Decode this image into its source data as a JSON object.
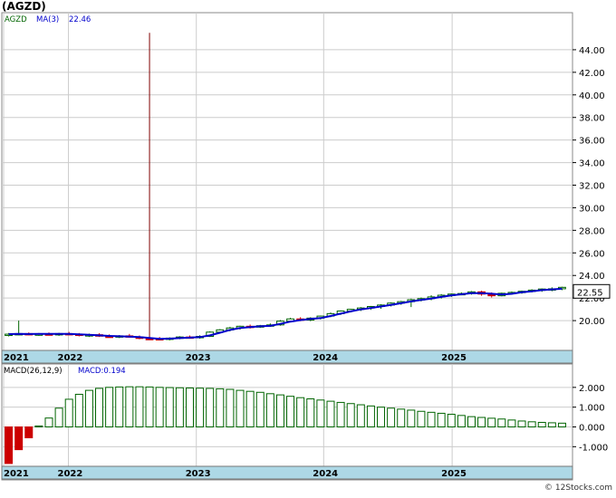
{
  "header": {
    "title": "(AGZD)",
    "symbol": "AGZD",
    "ma_label": "MA(3)",
    "ma_value": "22.46"
  },
  "footer": {
    "credit": "© 12Stocks.com"
  },
  "colors": {
    "up_candle": "#006400",
    "down_candle": "#cc0000",
    "ma_line": "#0000cc",
    "axis_band": "#add8e6",
    "grid": "#cccccc",
    "macd_bar_pos": "#006400",
    "macd_bar_neg": "#cc0000",
    "spike": "#800000"
  },
  "chart_data": [
    {
      "type": "candlestick",
      "symbol": "AGZD",
      "last_price_label": "22.55",
      "ylim": [
        17.6,
        46.0
      ],
      "y_ticks": [
        "20.00",
        "22.00",
        "24.00",
        "26.00",
        "28.00",
        "30.00",
        "32.00",
        "34.00",
        "36.00",
        "38.00",
        "40.00",
        "42.00",
        "44.00"
      ],
      "x_ticks": [
        "2021",
        "2022",
        "2023",
        "2024",
        "2025"
      ],
      "grid": true,
      "series": [
        {
          "name": "AGZD",
          "ohlc": [
            [
              18.75,
              18.9,
              18.6,
              18.8
            ],
            [
              18.8,
              20.0,
              18.7,
              18.85
            ],
            [
              18.85,
              18.95,
              18.7,
              18.78
            ],
            [
              18.78,
              18.9,
              18.65,
              18.82
            ],
            [
              18.82,
              18.95,
              18.7,
              18.8
            ],
            [
              18.8,
              18.92,
              18.65,
              18.85
            ],
            [
              18.85,
              19.0,
              18.72,
              18.8
            ],
            [
              18.8,
              18.9,
              18.6,
              18.7
            ],
            [
              18.7,
              18.85,
              18.55,
              18.75
            ],
            [
              18.75,
              18.88,
              18.55,
              18.62
            ],
            [
              18.62,
              18.78,
              18.48,
              18.55
            ],
            [
              18.55,
              18.72,
              18.45,
              18.65
            ],
            [
              18.65,
              18.82,
              18.5,
              18.55
            ],
            [
              18.55,
              18.68,
              18.35,
              18.42
            ],
            [
              18.42,
              45.5,
              18.3,
              18.4
            ],
            [
              18.4,
              18.55,
              18.25,
              18.35
            ],
            [
              18.35,
              18.52,
              18.25,
              18.45
            ],
            [
              18.45,
              18.62,
              18.35,
              18.55
            ],
            [
              18.55,
              18.68,
              18.4,
              18.48
            ],
            [
              18.48,
              18.7,
              18.4,
              18.6
            ],
            [
              18.6,
              19.05,
              18.55,
              18.98
            ],
            [
              18.98,
              19.25,
              18.9,
              19.18
            ],
            [
              19.18,
              19.45,
              19.05,
              19.35
            ],
            [
              19.35,
              19.55,
              19.2,
              19.5
            ],
            [
              19.5,
              19.65,
              19.3,
              19.42
            ],
            [
              19.42,
              19.62,
              19.35,
              19.55
            ],
            [
              19.55,
              19.75,
              19.45,
              19.62
            ],
            [
              19.62,
              20.05,
              19.55,
              19.95
            ],
            [
              19.95,
              20.25,
              19.85,
              20.15
            ],
            [
              20.15,
              20.3,
              19.95,
              20.05
            ],
            [
              20.05,
              20.3,
              19.95,
              20.22
            ],
            [
              20.22,
              20.45,
              20.1,
              20.4
            ],
            [
              20.4,
              20.72,
              20.3,
              20.62
            ],
            [
              20.62,
              20.9,
              20.5,
              20.85
            ],
            [
              20.85,
              21.05,
              20.72,
              21.0
            ],
            [
              21.0,
              21.2,
              20.85,
              21.12
            ],
            [
              21.12,
              21.3,
              20.95,
              21.25
            ],
            [
              21.25,
              21.45,
              21.05,
              21.38
            ],
            [
              21.38,
              21.62,
              21.25,
              21.55
            ],
            [
              21.55,
              21.75,
              21.4,
              21.68
            ],
            [
              21.68,
              21.95,
              21.2,
              21.85
            ],
            [
              21.85,
              22.05,
              21.7,
              21.95
            ],
            [
              21.95,
              22.25,
              21.8,
              22.1
            ],
            [
              22.1,
              22.35,
              21.95,
              22.25
            ],
            [
              22.25,
              22.4,
              22.1,
              22.35
            ],
            [
              22.35,
              22.5,
              22.25,
              22.4
            ],
            [
              22.4,
              22.62,
              22.3,
              22.55
            ],
            [
              22.55,
              22.65,
              22.2,
              22.35
            ],
            [
              22.35,
              22.5,
              22.05,
              22.2
            ],
            [
              22.2,
              22.48,
              22.15,
              22.42
            ],
            [
              22.42,
              22.58,
              22.3,
              22.5
            ],
            [
              22.5,
              22.66,
              22.38,
              22.6
            ],
            [
              22.6,
              22.78,
              22.5,
              22.7
            ],
            [
              22.7,
              22.85,
              22.55,
              22.8
            ],
            [
              22.8,
              22.95,
              22.6,
              22.82
            ],
            [
              22.82,
              23.0,
              22.7,
              22.95
            ]
          ]
        },
        {
          "name": "MA(3)",
          "values": [
            18.8,
            18.82,
            18.81,
            18.82,
            18.82,
            18.82,
            18.82,
            18.78,
            18.75,
            18.69,
            18.64,
            18.61,
            18.58,
            18.54,
            18.46,
            18.39,
            18.4,
            18.45,
            18.49,
            18.54,
            18.69,
            18.92,
            19.17,
            19.34,
            19.42,
            19.49,
            19.53,
            19.71,
            19.91,
            20.05,
            20.14,
            20.22,
            20.41,
            20.62,
            20.82,
            20.99,
            21.12,
            21.25,
            21.39,
            21.54,
            21.7,
            21.83,
            21.96,
            22.1,
            22.23,
            22.33,
            22.43,
            22.43,
            22.38,
            22.32,
            22.37,
            22.51,
            22.6,
            22.7,
            22.77,
            22.82
          ]
        }
      ]
    },
    {
      "type": "bar",
      "label": "MACD(26,12,9)",
      "value_label": "MACD:0.194",
      "ylim": [
        -1.9,
        2.45
      ],
      "y_ticks": [
        "-1.000",
        "0.000",
        "1.000",
        "2.000"
      ],
      "x_ticks": [
        "2021",
        "2022",
        "2023",
        "2024",
        "2025"
      ],
      "grid": true,
      "series": [
        {
          "name": "MACD",
          "values": [
            -1.85,
            -1.15,
            -0.55,
            0.05,
            0.45,
            0.95,
            1.4,
            1.65,
            1.85,
            1.95,
            2.0,
            2.02,
            2.03,
            2.03,
            2.02,
            2.0,
            1.99,
            1.98,
            1.97,
            1.96,
            1.95,
            1.93,
            1.9,
            1.85,
            1.8,
            1.75,
            1.68,
            1.62,
            1.55,
            1.48,
            1.42,
            1.36,
            1.3,
            1.24,
            1.18,
            1.12,
            1.06,
            1.0,
            0.95,
            0.9,
            0.85,
            0.79,
            0.74,
            0.69,
            0.64,
            0.58,
            0.52,
            0.48,
            0.44,
            0.4,
            0.35,
            0.3,
            0.26,
            0.23,
            0.21,
            0.19
          ]
        }
      ]
    }
  ]
}
